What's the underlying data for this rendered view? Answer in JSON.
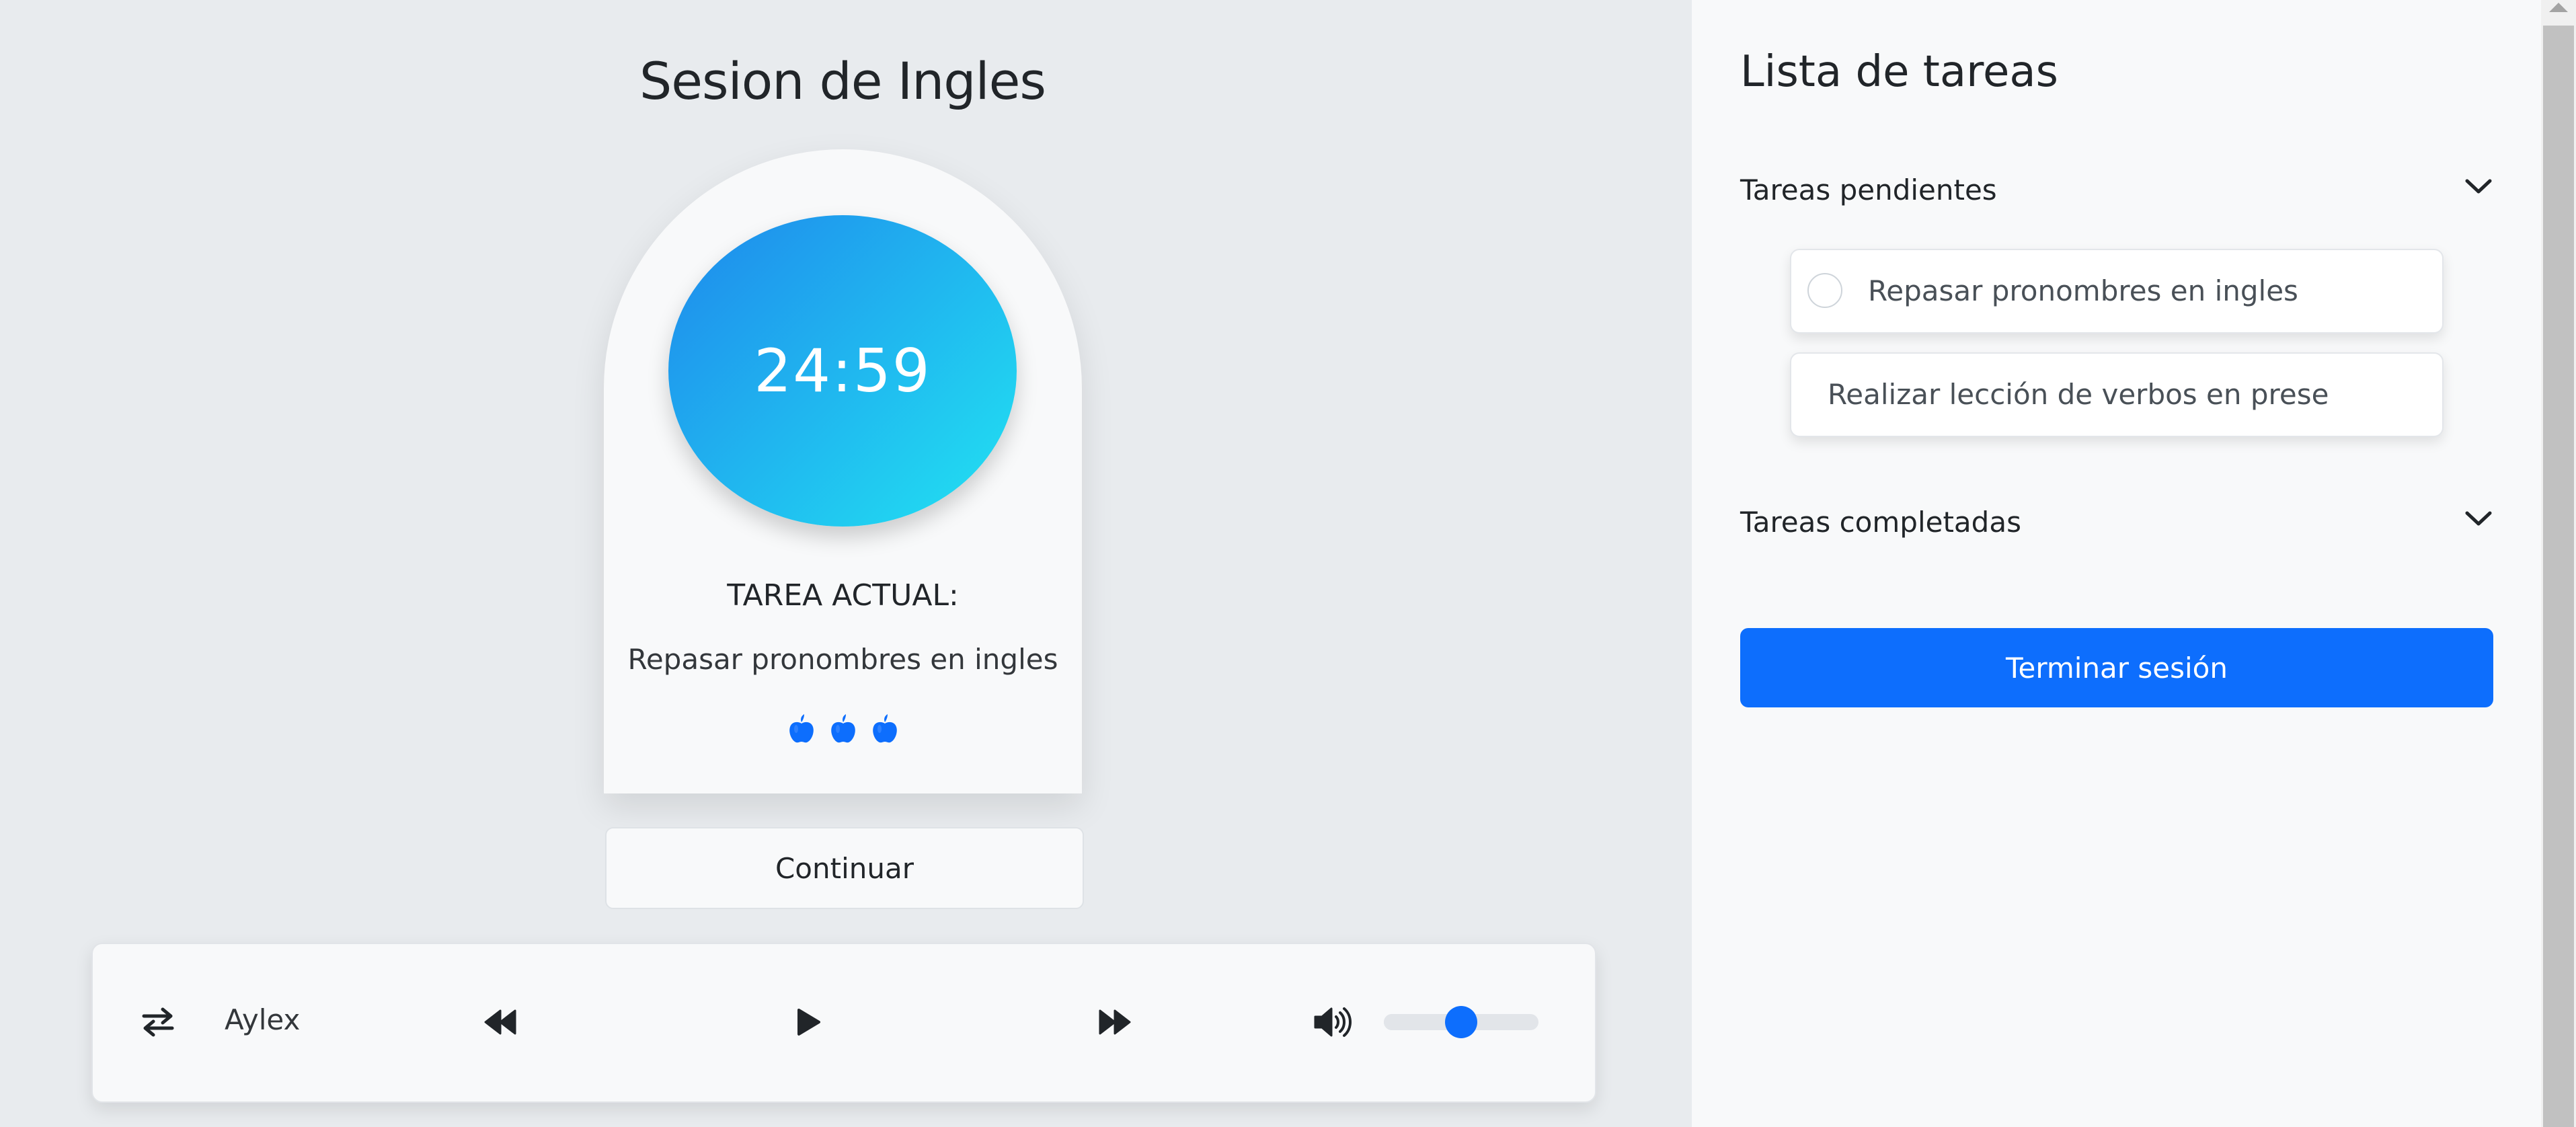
{
  "session": {
    "title": "Sesion de Ingles",
    "timer": "24:59",
    "current_task_label": "TAREA ACTUAL:",
    "current_task": "Repasar pronombres en ingles",
    "pomodoro_icons": [
      "apple-icon",
      "apple-icon",
      "apple-icon"
    ],
    "continue_label": "Continuar"
  },
  "player": {
    "artist": "Aylex",
    "icons": [
      "shuffle-icon",
      "rewind-icon",
      "play-icon",
      "fast-forward-icon",
      "volume-icon"
    ],
    "volume": 0.5
  },
  "tasks": {
    "title": "Lista de tareas",
    "pending_label": "Tareas pendientes",
    "pending": [
      {
        "label": "Repasar pronombres en ingles",
        "has_radio": true
      },
      {
        "label": "Realizar lección de verbos en prese",
        "has_radio": false
      }
    ],
    "completed_label": "Tareas completadas",
    "end_label": "Terminar sesión"
  },
  "colors": {
    "accent": "#0d6efd",
    "timer_gradient_start": "#1e88ec",
    "timer_gradient_end": "#22e3f2",
    "background": "#e9ecef",
    "panel": "#f8f9fa"
  }
}
